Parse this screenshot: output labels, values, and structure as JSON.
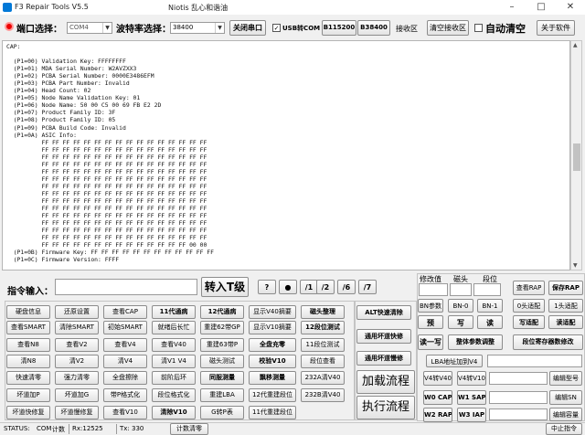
{
  "window": {
    "title": "F3 Repair Tools V5.5",
    "subtitle": "Niotis 乱心和谐油"
  },
  "toolbar": {
    "port_label": "端口选择：",
    "port_value": "COM4",
    "baud_label": "波特率选择：",
    "baud_value": "38400",
    "close_port": "关闭串口",
    "usb_com_label": "USB转COM",
    "usb_com_checked": "✓",
    "b115200": "B115200",
    "b38400": "B38400",
    "recv_area": "接收区",
    "clear_recv": "清空接收区",
    "auto_clear": "自动清空",
    "about": "关于软件"
  },
  "console": {
    "text": "CAP:\n\n  (P1=00) Validation Key: FFFFFFFF\n  (P1=01) MDA Serial Number: W2AVZXX3\n  (P1=02) PCBA Serial Number: 0000E3486EFM\n  (P1=03) PCBA Part Number: Invalid\n  (P1=04) Head Count: 02\n  (P1=05) Node Name Validation Key: 01\n  (P1=06) Node Name: 50 00 C5 00 69 FB E2 2D\n  (P1=07) Product Family ID: 3F\n  (P1=08) Product Family ID: 05\n  (P1=09) PCBA Build Code: Invalid\n  (P1=0A) ASIC Info:\n          FF FF FF FF FF FF FF FF FF FF FF FF FF FF FF FF\n          FF FF FF FF FF FF FF FF FF FF FF FF FF FF FF FF\n          FF FF FF FF FF FF FF FF FF FF FF FF FF FF FF FF\n          FF FF FF FF FF FF FF FF FF FF FF FF FF FF FF FF\n          FF FF FF FF FF FF FF FF FF FF FF FF FF FF FF FF\n          FF FF FF FF FF FF FF FF FF FF FF FF FF FF FF FF\n          FF FF FF FF FF FF FF FF FF FF FF FF FF FF FF FF\n          FF FF FF FF FF FF FF FF FF FF FF FF FF FF FF FF\n          FF FF FF FF FF FF FF FF FF FF FF FF FF FF FF FF\n          FF FF FF FF FF FF FF FF FF FF FF FF FF FF FF FF\n          FF FF FF FF FF FF FF FF FF FF FF FF FF FF FF FF\n          FF FF FF FF FF FF FF FF FF FF FF FF FF FF FF FF\n          FF FF FF FF FF FF FF FF FF FF FF FF FF FF FF FF\n          FF FF FF FF FF FF FF FF FF FF FF FF FF FF FF FF\n          FF FF FF FF FF FF FF FF FF FF FF FF FF FF 00 00\n  (P1=0B) Firmware Key: FF FF FF FF FF FF FF FF FF FF FF FF\n  (P1=0C) Firmware Version: FFFF"
  },
  "cmd": {
    "label": "指令输入：",
    "send": "转入T级",
    "quick": [
      "?",
      "●",
      "/1",
      "/2",
      "/6",
      "/7"
    ]
  },
  "grid": [
    [
      "硬盘信息",
      "还原设置",
      "查看CAP",
      "11代通病",
      "12代通病",
      "显示V40摘要",
      "磁头整理"
    ],
    [
      "查看SMART",
      "清除SMART",
      "初始SMART",
      "就绪后长忙",
      "重建62带GP",
      "显示V10摘要",
      "12段位测试"
    ],
    [
      "查看N8",
      "查看V2",
      "查看V4",
      "查看V40",
      "重建63带P",
      "全盘充零",
      "11段位测试"
    ],
    [
      "清N8",
      "清V2",
      "清V4",
      "清V1 V4",
      "磁头测试",
      "校验V10",
      "段位查看"
    ],
    [
      "快速清零",
      "强力清零",
      "全盘擦除",
      "前阶后环",
      "同服测量",
      "飘移测量",
      "232A清V40"
    ],
    [
      "坏道加P",
      "坏道加G",
      "带P格式化",
      "段位格式化",
      "重建LBA",
      "12代重建段位",
      "232B清V40"
    ],
    [
      "坏道快修复",
      "坏道慢修复",
      "查看V10",
      "清除V10",
      "G转P表",
      "11代重建段位",
      ""
    ]
  ],
  "middle": {
    "alt_clear": "ALT快速清除",
    "univ_fix": "通用坏道快修",
    "univ_fix2": "通用坏道慢修",
    "load_flow": "加载流程",
    "exec_flow": "执行流程"
  },
  "right": {
    "header_fix": "修改值",
    "header_head": "磁头",
    "header_seg": "段位",
    "view_rap": "查看RAP",
    "save_rap": "保存RAP",
    "btn_bnparam": "BN参数",
    "btn_bn0": "BN-0",
    "btn_bn1": "BN-1",
    "btn_0head": "0头适配",
    "btn_1head": "1头适配",
    "btn_pre": "预",
    "btn_write": "写",
    "btn_read": "读",
    "btn_writecfg": "写适配",
    "btn_readcfg": "读适配",
    "read_write": "读一写",
    "whole_adj": "整体参数调整",
    "seg_reg_mod": "段位寄存器数修改",
    "lba_label": "LBA地址加到V4",
    "v4v40": "V4转V40",
    "v4v10": "V4转V10",
    "edit_model": "编辑型号",
    "w0cap": "W0 CAP",
    "w1sap": "W1 SAP",
    "edit_sn": "编辑SN",
    "w2rap": "W2 RAP",
    "w3iap": "W3 IAP",
    "edit_cap": "编辑容量"
  },
  "status": {
    "status_label": "STATUS:",
    "port": "COM",
    "count_label": "计数",
    "rx": "Rx:12525",
    "tx": "Tx: 330",
    "count_clear": "计数清零",
    "stop": "中止指令"
  }
}
